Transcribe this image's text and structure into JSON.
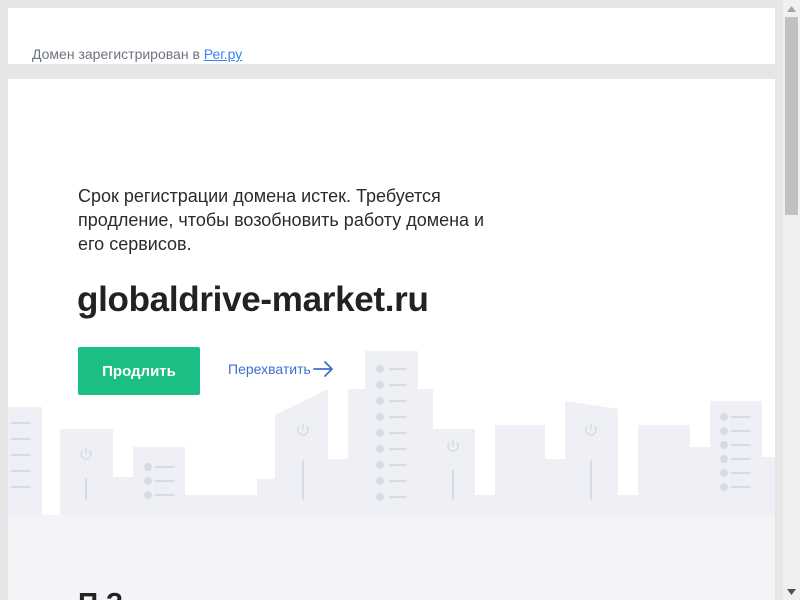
{
  "header": {
    "registered_text": "Домен зарегистрирован в ",
    "registrar_link": "Рег.ру"
  },
  "main": {
    "message": "Срок регистрации домена истек. Требуется продление, чтобы возобновить работу домена и его сервисов.",
    "domain": "globaldrive-market.ru",
    "renew_button": "Продлить",
    "intercept_link": "Перехватить",
    "next_heading_partial": "П                                         ?"
  },
  "colors": {
    "accent_green": "#1bbf83",
    "link_blue": "#3c6fd1",
    "registrar_link": "#3b82f6"
  },
  "icons": [
    "arrow-right-icon",
    "power-icon",
    "list-dots-icon",
    "scroll-up-icon",
    "scroll-down-icon"
  ]
}
